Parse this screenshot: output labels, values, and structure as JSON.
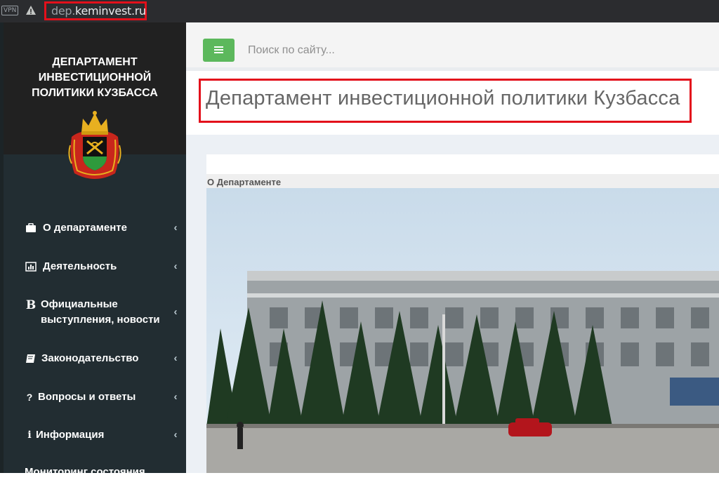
{
  "browser": {
    "vpn_label": "VPN",
    "url_prefix": "dep.",
    "url_host": "keminvest.ru"
  },
  "sidebar": {
    "org_title": "ДЕПАРТАМЕНТ ИНВЕСТИЦИОННОЙ ПОЛИТИКИ КУЗБАССА",
    "emblem": "kuzbass-coat-of-arms",
    "items": [
      {
        "label": "О департаменте",
        "icon": "briefcase-icon"
      },
      {
        "label": "Деятельность",
        "icon": "bar-chart-icon"
      },
      {
        "label": "Официальные выступления, новости",
        "icon": "bold-b-icon"
      },
      {
        "label": "Законодательство",
        "icon": "book-icon"
      },
      {
        "label": "Вопросы и ответы",
        "icon": "question-icon"
      },
      {
        "label": "Информация",
        "icon": "info-icon"
      },
      {
        "label": "Мониторинг состояния",
        "icon": ""
      }
    ]
  },
  "topbar": {
    "search_placeholder": "Поиск по сайту...",
    "menu_icon": "hamburger-icon"
  },
  "main": {
    "page_title": "Департамент инвестиционной политики Кузбасса",
    "section_label": "О Департаменте"
  },
  "colors": {
    "sidebar_bg": "#222d32",
    "accent_green": "#5cb85c",
    "highlight_red": "#e3101b"
  }
}
